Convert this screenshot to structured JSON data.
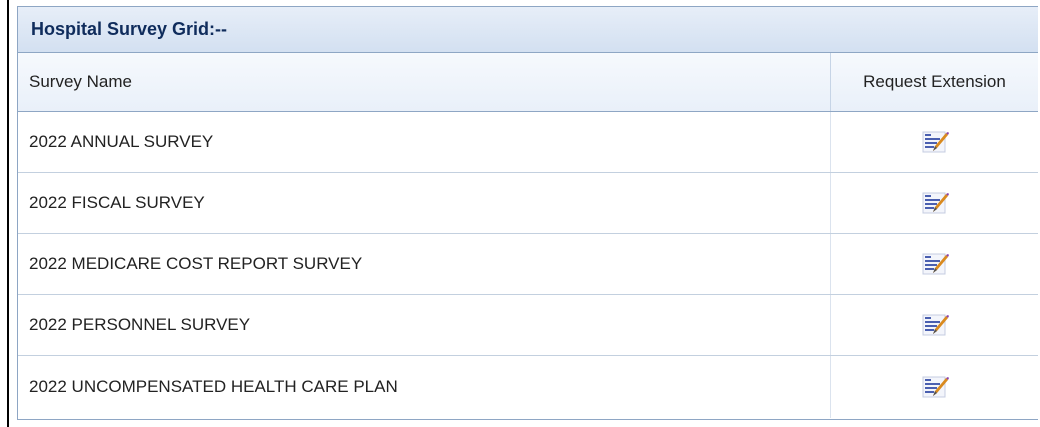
{
  "grid": {
    "title": "Hospital Survey Grid:--",
    "columns": {
      "name": "Survey Name",
      "extension": "Request Extension"
    },
    "rows": [
      {
        "name": "2022 ANNUAL SURVEY",
        "action_icon": "edit-icon"
      },
      {
        "name": "2022 FISCAL SURVEY",
        "action_icon": "edit-icon"
      },
      {
        "name": "2022 MEDICARE COST REPORT SURVEY",
        "action_icon": "edit-icon"
      },
      {
        "name": "2022 PERSONNEL SURVEY",
        "action_icon": "edit-icon"
      },
      {
        "name": "2022 UNCOMPENSATED HEALTH CARE PLAN",
        "action_icon": "edit-icon"
      }
    ]
  },
  "colors": {
    "title_text": "#0f2c5c",
    "title_bg": "#d3e0f1",
    "border": "#8ea6c4",
    "icon_lines": "#4a5fb0",
    "icon_pencil": "#d98a1f",
    "icon_tip": "#8a3fa8"
  }
}
